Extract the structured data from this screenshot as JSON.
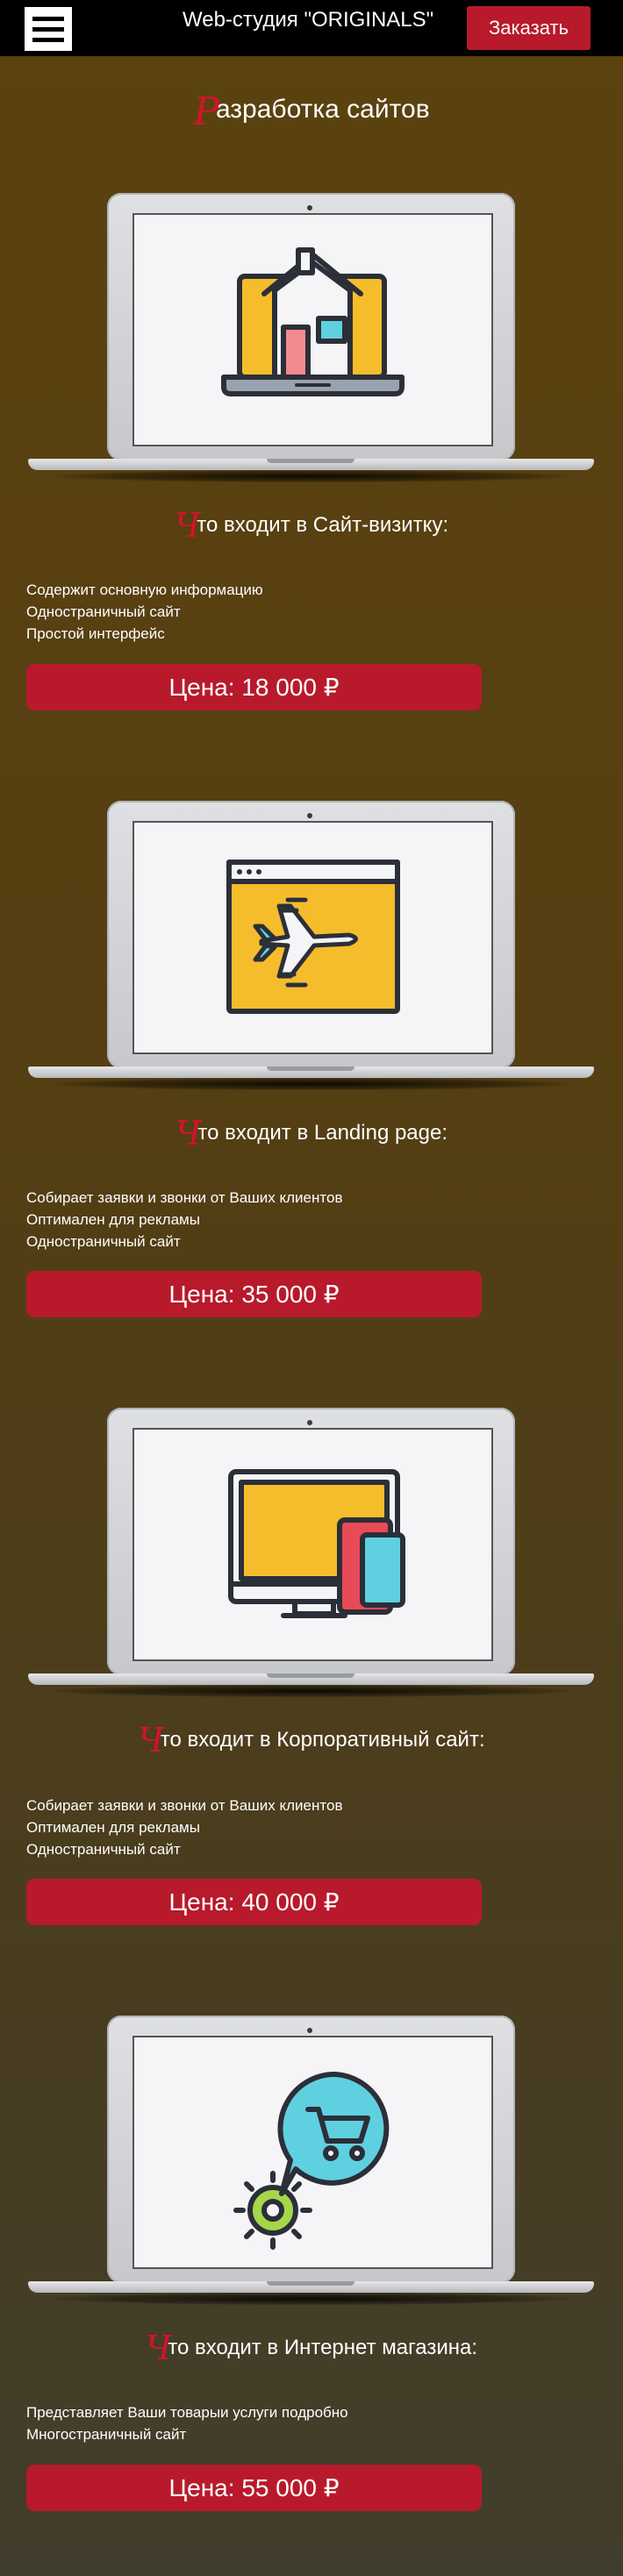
{
  "header": {
    "brand": "Web-студия \"ORIGINALS\"",
    "order_button": "Заказать"
  },
  "page_title": {
    "first_letter": "Р",
    "rest": "азработка сайтов"
  },
  "accent_color": "#b81a2c",
  "sections": [
    {
      "icon": "house-icon",
      "heading_first": "Ч",
      "heading_rest": "то входит в Сайт-визитку:",
      "features": [
        "Содержит основную информацию",
        "Одностраничный сайт",
        "Простой интерфейс"
      ],
      "price": "Цена: 18 000 ₽"
    },
    {
      "icon": "airplane-window-icon",
      "heading_first": "Ч",
      "heading_rest": "то входит в Landing page:",
      "features": [
        "Собирает заявки и звонки от Ваших клиентов",
        "Оптимален для рекламы",
        "Одностраничный сайт"
      ],
      "price": "Цена: 35 000 ₽"
    },
    {
      "icon": "devices-icon",
      "heading_first": "Ч",
      "heading_rest": "то входит в Корпоративный сайт:",
      "features": [
        "Собирает заявки и звонки от Ваших клиентов",
        "Оптимален для рекламы",
        "Одностраничный сайт"
      ],
      "price": "Цена: 40 000 ₽"
    },
    {
      "icon": "shopping-cart-gear-icon",
      "heading_first": "Ч",
      "heading_rest": "то входит в Интернет магазина:",
      "features": [
        "Представляет Ваши товарыи услуги подробно",
        "Многостраничный сайт"
      ],
      "price": "Цена: 55 000 ₽"
    }
  ]
}
